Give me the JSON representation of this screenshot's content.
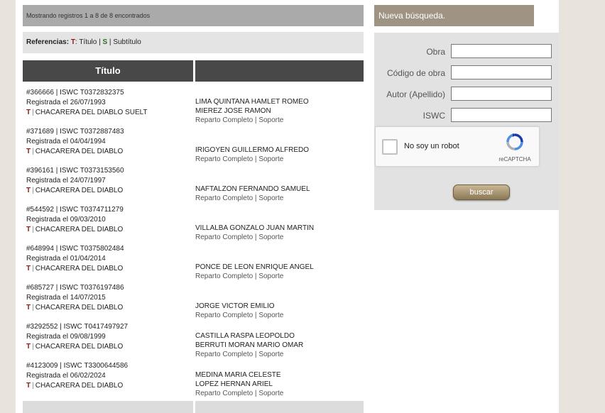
{
  "status": {
    "text": "Mostrando registros 1 a 8 de 8 encontrados"
  },
  "references": {
    "label": "Referencias:",
    "t_code": "T",
    "t_label": "Título",
    "s_code": "S",
    "s_label": "Subtítulo"
  },
  "table": {
    "header_title": "Título",
    "header_second": "",
    "rows": [
      {
        "id_line": "#366666 | ISWC T0372832375",
        "registered": "Registrada el 26/07/1993",
        "type": "T",
        "title": "CHACARERA DEL DIABLO SUELT",
        "authors": [
          "LIMA QUINTANA HAMLET ROMEO",
          "MIEREZ JOSE RAMON"
        ],
        "link_reparto": "Reparto Completo",
        "link_soporte": "Soporte"
      },
      {
        "id_line": "#371689 | ISWC T0372887483",
        "registered": "Registrada el 04/04/1994",
        "type": "T",
        "title": "CHACARERA DEL DIABLO",
        "authors": [
          "IRIGOYEN GUILLERMO ALFREDO"
        ],
        "link_reparto": "Reparto Completo",
        "link_soporte": "Soporte"
      },
      {
        "id_line": "#396161 | ISWC T0373153560",
        "registered": "Registrada el 24/07/1997",
        "type": "T",
        "title": "CHACARERA DEL DIABLO",
        "authors": [
          "NAFTALZON FERNANDO SAMUEL"
        ],
        "link_reparto": "Reparto Completo",
        "link_soporte": "Soporte"
      },
      {
        "id_line": "#544592 | ISWC T0374711279",
        "registered": "Registrada el 09/03/2010",
        "type": "T",
        "title": "CHACARERA DEL DIABLO",
        "authors": [
          "VILLALBA GONZALO JUAN MARTIN"
        ],
        "link_reparto": "Reparto Completo",
        "link_soporte": "Soporte"
      },
      {
        "id_line": "#648994 | ISWC T0375802484",
        "registered": "Registrada el 01/04/2014",
        "type": "T",
        "title": "CHACARERA DEL DIABLO",
        "authors": [
          "PONCE DE LEON ENRIQUE ANGEL"
        ],
        "link_reparto": "Reparto Completo",
        "link_soporte": "Soporte"
      },
      {
        "id_line": "#685727 | ISWC T0376197486",
        "registered": "Registrada el 14/07/2015",
        "type": "T",
        "title": "CHACARERA DEL DIABLO",
        "authors": [
          "JORGE VICTOR EMILIO"
        ],
        "link_reparto": "Reparto Completo",
        "link_soporte": "Soporte"
      },
      {
        "id_line": "#3292552 | ISWC T0417497927",
        "registered": "Registrada el 09/08/1999",
        "type": "T",
        "title": "CHACARERA DEL DIABLO",
        "authors": [
          "CASTILLA RASPA LEOPOLDO",
          "BERRUTI MORAN MARIO OMAR"
        ],
        "link_reparto": "Reparto Completo",
        "link_soporte": "Soporte"
      },
      {
        "id_line": "#4123009 | ISWC T3300644586",
        "registered": "Registrada el 06/02/2024",
        "type": "T",
        "title": "CHACARERA DEL DIABLO",
        "authors": [
          "MEDINA MARIA CELESTE",
          "LOPEZ HERNAN ARIEL"
        ],
        "link_reparto": "Reparto Completo",
        "link_soporte": "Soporte"
      }
    ]
  },
  "search": {
    "header": "Nueva búsqueda.",
    "fields": [
      {
        "label": "Obra",
        "value": ""
      },
      {
        "label": "Código de obra",
        "value": ""
      },
      {
        "label": "Autor (Apellido)",
        "value": ""
      },
      {
        "label": "ISWC",
        "value": ""
      }
    ],
    "captcha_label": "No soy un robot",
    "captcha_brand": "reCAPTCHA",
    "submit_label": "buscar"
  },
  "icons": {
    "captcha": "recaptcha-icon"
  },
  "colors": {
    "table_header": "#484848",
    "status_bar": "#aaaaaa",
    "search_header": "#9f9483",
    "accent_t": "#8b1a1a",
    "accent_s": "#2a6a2a"
  }
}
